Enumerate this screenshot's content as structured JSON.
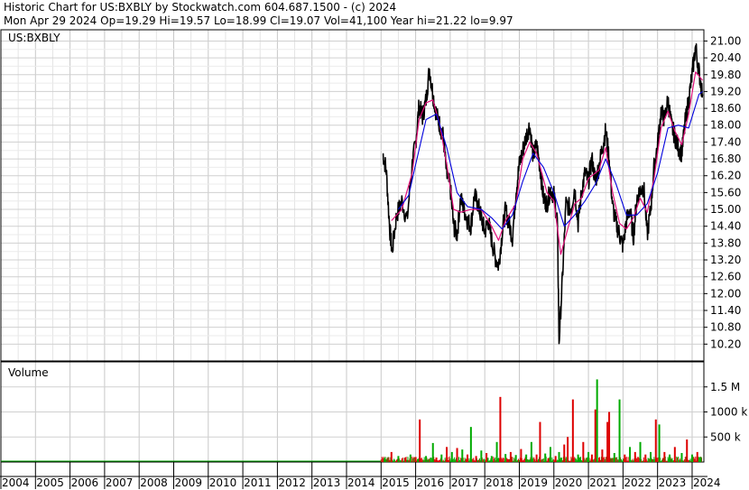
{
  "header": {
    "line1": "Historic Chart for US:BXBLY by Stockwatch.com 604.687.1500 - (c) 2024",
    "line2": "Mon Apr 29 2024   Op=19.29   Hi=19.57   Lo=18.99   Cl=19.07   Vol=41,100   Year hi=21.22   lo=9.97"
  },
  "chart_data": [
    {
      "type": "line",
      "panel": "price",
      "label": "US:BXBLY",
      "x_range": [
        "2004",
        "2024.3"
      ],
      "ylim": [
        9.6,
        21.4
      ],
      "yticks": [
        "21.00",
        "20.40",
        "19.80",
        "19.20",
        "18.60",
        "18.00",
        "17.40",
        "16.80",
        "16.20",
        "15.60",
        "15.00",
        "14.40",
        "13.80",
        "13.20",
        "12.60",
        "12.00",
        "11.40",
        "10.80",
        "10.20"
      ],
      "grid": true,
      "colors": {
        "price": "#000000",
        "ma_short": "#e0107a",
        "ma_long": "#0000dd"
      },
      "series": [
        {
          "values_xy": [
            [
              2015.05,
              17.0
            ],
            [
              2015.15,
              16.4
            ],
            [
              2015.25,
              14.3
            ],
            [
              2015.32,
              13.5
            ],
            [
              2015.45,
              14.8
            ],
            [
              2015.6,
              15.3
            ],
            [
              2015.75,
              14.6
            ],
            [
              2015.9,
              16.6
            ],
            [
              2016.0,
              17.4
            ],
            [
              2016.1,
              18.7
            ],
            [
              2016.2,
              18.3
            ],
            [
              2016.3,
              18.9
            ],
            [
              2016.4,
              20.0
            ],
            [
              2016.5,
              19.1
            ],
            [
              2016.6,
              18.4
            ],
            [
              2016.7,
              18.0
            ],
            [
              2016.8,
              17.6
            ],
            [
              2016.9,
              16.2
            ],
            [
              2017.0,
              15.8
            ],
            [
              2017.1,
              14.4
            ],
            [
              2017.2,
              14.1
            ],
            [
              2017.3,
              15.4
            ],
            [
              2017.4,
              15.0
            ],
            [
              2017.5,
              14.6
            ],
            [
              2017.6,
              14.4
            ],
            [
              2017.7,
              15.5
            ],
            [
              2017.8,
              15.2
            ],
            [
              2017.9,
              14.7
            ],
            [
              2018.0,
              14.2
            ],
            [
              2018.1,
              14.6
            ],
            [
              2018.2,
              13.9
            ],
            [
              2018.3,
              13.3
            ],
            [
              2018.4,
              13.0
            ],
            [
              2018.5,
              14.1
            ],
            [
              2018.6,
              15.0
            ],
            [
              2018.7,
              14.5
            ],
            [
              2018.8,
              14.0
            ],
            [
              2018.9,
              15.6
            ],
            [
              2019.0,
              16.6
            ],
            [
              2019.1,
              17.1
            ],
            [
              2019.2,
              17.6
            ],
            [
              2019.3,
              18.0
            ],
            [
              2019.4,
              16.9
            ],
            [
              2019.5,
              17.3
            ],
            [
              2019.6,
              16.5
            ],
            [
              2019.7,
              15.4
            ],
            [
              2019.8,
              15.2
            ],
            [
              2019.9,
              15.7
            ],
            [
              2020.0,
              15.5
            ],
            [
              2020.1,
              14.6
            ],
            [
              2020.15,
              10.3
            ],
            [
              2020.25,
              12.6
            ],
            [
              2020.35,
              15.2
            ],
            [
              2020.5,
              15.0
            ],
            [
              2020.6,
              15.8
            ],
            [
              2020.7,
              14.5
            ],
            [
              2020.8,
              15.6
            ],
            [
              2020.9,
              16.3
            ],
            [
              2021.0,
              16.0
            ],
            [
              2021.1,
              16.8
            ],
            [
              2021.2,
              16.0
            ],
            [
              2021.3,
              16.5
            ],
            [
              2021.4,
              17.2
            ],
            [
              2021.5,
              17.8
            ],
            [
              2021.6,
              16.8
            ],
            [
              2021.7,
              15.1
            ],
            [
              2021.8,
              14.5
            ],
            [
              2021.9,
              14.1
            ],
            [
              2022.0,
              13.7
            ],
            [
              2022.1,
              14.6
            ],
            [
              2022.2,
              15.0
            ],
            [
              2022.3,
              14.0
            ],
            [
              2022.4,
              15.4
            ],
            [
              2022.5,
              15.7
            ],
            [
              2022.6,
              15.8
            ],
            [
              2022.7,
              14.1
            ],
            [
              2022.8,
              15.0
            ],
            [
              2022.9,
              16.5
            ],
            [
              2023.0,
              17.3
            ],
            [
              2023.1,
              18.5
            ],
            [
              2023.2,
              18.2
            ],
            [
              2023.3,
              18.9
            ],
            [
              2023.4,
              18.0
            ],
            [
              2023.5,
              17.6
            ],
            [
              2023.6,
              17.2
            ],
            [
              2023.7,
              17.0
            ],
            [
              2023.8,
              18.1
            ],
            [
              2023.9,
              18.9
            ],
            [
              2024.0,
              19.8
            ],
            [
              2024.1,
              20.8
            ],
            [
              2024.2,
              19.9
            ],
            [
              2024.3,
              19.1
            ]
          ]
        },
        {
          "values_xy": [
            [
              2015.3,
              14.6
            ],
            [
              2015.6,
              15.0
            ],
            [
              2015.9,
              16.3
            ],
            [
              2016.1,
              18.2
            ],
            [
              2016.3,
              18.8
            ],
            [
              2016.5,
              18.9
            ],
            [
              2016.7,
              18.0
            ],
            [
              2016.9,
              16.6
            ],
            [
              2017.1,
              15.0
            ],
            [
              2017.3,
              14.9
            ],
            [
              2017.6,
              15.0
            ],
            [
              2017.9,
              15.0
            ],
            [
              2018.2,
              14.4
            ],
            [
              2018.4,
              13.9
            ],
            [
              2018.6,
              14.6
            ],
            [
              2018.9,
              15.2
            ],
            [
              2019.1,
              16.8
            ],
            [
              2019.3,
              17.4
            ],
            [
              2019.5,
              17.0
            ],
            [
              2019.8,
              15.6
            ],
            [
              2020.0,
              15.3
            ],
            [
              2020.2,
              13.4
            ],
            [
              2020.4,
              14.3
            ],
            [
              2020.6,
              15.2
            ],
            [
              2020.8,
              15.4
            ],
            [
              2021.0,
              16.1
            ],
            [
              2021.3,
              16.4
            ],
            [
              2021.5,
              17.2
            ],
            [
              2021.7,
              15.6
            ],
            [
              2021.9,
              14.5
            ],
            [
              2022.1,
              14.3
            ],
            [
              2022.3,
              14.7
            ],
            [
              2022.5,
              15.4
            ],
            [
              2022.7,
              14.9
            ],
            [
              2022.9,
              16.1
            ],
            [
              2023.1,
              17.9
            ],
            [
              2023.3,
              18.5
            ],
            [
              2023.5,
              17.8
            ],
            [
              2023.7,
              17.3
            ],
            [
              2023.9,
              18.4
            ],
            [
              2024.1,
              19.9
            ],
            [
              2024.3,
              19.6
            ]
          ]
        },
        {
          "values_xy": [
            [
              2015.5,
              15.0
            ],
            [
              2015.8,
              15.5
            ],
            [
              2016.0,
              16.6
            ],
            [
              2016.3,
              18.2
            ],
            [
              2016.6,
              18.4
            ],
            [
              2016.9,
              17.2
            ],
            [
              2017.2,
              15.6
            ],
            [
              2017.5,
              15.1
            ],
            [
              2017.9,
              15.0
            ],
            [
              2018.2,
              14.7
            ],
            [
              2018.5,
              14.3
            ],
            [
              2018.8,
              14.8
            ],
            [
              2019.1,
              16.0
            ],
            [
              2019.4,
              17.0
            ],
            [
              2019.7,
              16.5
            ],
            [
              2020.0,
              15.6
            ],
            [
              2020.3,
              14.4
            ],
            [
              2020.6,
              14.8
            ],
            [
              2020.9,
              15.3
            ],
            [
              2021.2,
              15.9
            ],
            [
              2021.5,
              16.8
            ],
            [
              2021.8,
              15.9
            ],
            [
              2022.1,
              14.8
            ],
            [
              2022.4,
              14.8
            ],
            [
              2022.7,
              15.2
            ],
            [
              2023.0,
              16.3
            ],
            [
              2023.3,
              17.9
            ],
            [
              2023.6,
              18.0
            ],
            [
              2023.9,
              17.9
            ],
            [
              2024.2,
              19.1
            ],
            [
              2024.3,
              19.2
            ]
          ]
        }
      ]
    },
    {
      "type": "bar",
      "panel": "volume",
      "title": "Volume",
      "x_range": [
        "2004",
        "2024.3"
      ],
      "ylim": [
        0,
        2000000
      ],
      "yticks": [
        "1.5 M",
        "1000 k",
        "500 k"
      ],
      "ytick_values": [
        1500000,
        1000000,
        500000
      ],
      "colors": {
        "up": "#00aa00",
        "down": "#dd0000"
      },
      "bars": [
        [
          2015.1,
          80000,
          "g"
        ],
        [
          2015.3,
          200000,
          "r"
        ],
        [
          2015.5,
          120000,
          "g"
        ],
        [
          2015.7,
          90000,
          "r"
        ],
        [
          2015.85,
          150000,
          "g"
        ],
        [
          2016.0,
          100000,
          "r"
        ],
        [
          2016.12,
          850000,
          "r"
        ],
        [
          2016.3,
          120000,
          "g"
        ],
        [
          2016.5,
          380000,
          "g"
        ],
        [
          2016.6,
          90000,
          "r"
        ],
        [
          2016.75,
          150000,
          "g"
        ],
        [
          2016.9,
          300000,
          "r"
        ],
        [
          2017.05,
          200000,
          "g"
        ],
        [
          2017.2,
          280000,
          "r"
        ],
        [
          2017.35,
          250000,
          "g"
        ],
        [
          2017.5,
          150000,
          "r"
        ],
        [
          2017.6,
          700000,
          "g"
        ],
        [
          2017.75,
          120000,
          "r"
        ],
        [
          2017.9,
          230000,
          "g"
        ],
        [
          2018.05,
          180000,
          "r"
        ],
        [
          2018.2,
          120000,
          "g"
        ],
        [
          2018.35,
          400000,
          "g"
        ],
        [
          2018.45,
          1300000,
          "r"
        ],
        [
          2018.6,
          160000,
          "g"
        ],
        [
          2018.75,
          200000,
          "r"
        ],
        [
          2018.9,
          140000,
          "g"
        ],
        [
          2019.05,
          260000,
          "r"
        ],
        [
          2019.2,
          150000,
          "g"
        ],
        [
          2019.35,
          400000,
          "g"
        ],
        [
          2019.5,
          150000,
          "r"
        ],
        [
          2019.6,
          800000,
          "r"
        ],
        [
          2019.75,
          170000,
          "g"
        ],
        [
          2019.9,
          300000,
          "g"
        ],
        [
          2020.05,
          120000,
          "r"
        ],
        [
          2020.15,
          200000,
          "g"
        ],
        [
          2020.3,
          350000,
          "r"
        ],
        [
          2020.4,
          500000,
          "r"
        ],
        [
          2020.55,
          1250000,
          "r"
        ],
        [
          2020.7,
          150000,
          "g"
        ],
        [
          2020.85,
          400000,
          "r"
        ],
        [
          2021.0,
          200000,
          "g"
        ],
        [
          2021.1,
          150000,
          "r"
        ],
        [
          2021.2,
          1050000,
          "r"
        ],
        [
          2021.25,
          1650000,
          "g"
        ],
        [
          2021.4,
          250000,
          "r"
        ],
        [
          2021.55,
          800000,
          "r"
        ],
        [
          2021.6,
          1000000,
          "r"
        ],
        [
          2021.75,
          180000,
          "g"
        ],
        [
          2021.9,
          1250000,
          "g"
        ],
        [
          2022.05,
          150000,
          "r"
        ],
        [
          2022.2,
          300000,
          "g"
        ],
        [
          2022.35,
          200000,
          "r"
        ],
        [
          2022.5,
          400000,
          "g"
        ],
        [
          2022.65,
          150000,
          "r"
        ],
        [
          2022.8,
          200000,
          "g"
        ],
        [
          2022.95,
          850000,
          "r"
        ],
        [
          2023.05,
          750000,
          "g"
        ],
        [
          2023.2,
          200000,
          "r"
        ],
        [
          2023.35,
          150000,
          "g"
        ],
        [
          2023.5,
          300000,
          "r"
        ],
        [
          2023.7,
          180000,
          "g"
        ],
        [
          2023.85,
          450000,
          "r"
        ],
        [
          2024.0,
          150000,
          "g"
        ],
        [
          2024.15,
          200000,
          "r"
        ],
        [
          2024.25,
          100000,
          "g"
        ]
      ]
    },
    {
      "type": "axis",
      "panel": "x",
      "year_labels": [
        "2004",
        "2005",
        "2006",
        "2007",
        "2008",
        "2009",
        "2010",
        "2011",
        "2012",
        "2013",
        "2014",
        "2015",
        "2016",
        "2017",
        "2018",
        "2019",
        "2020",
        "2021",
        "2022",
        "2023",
        "2024"
      ]
    }
  ]
}
